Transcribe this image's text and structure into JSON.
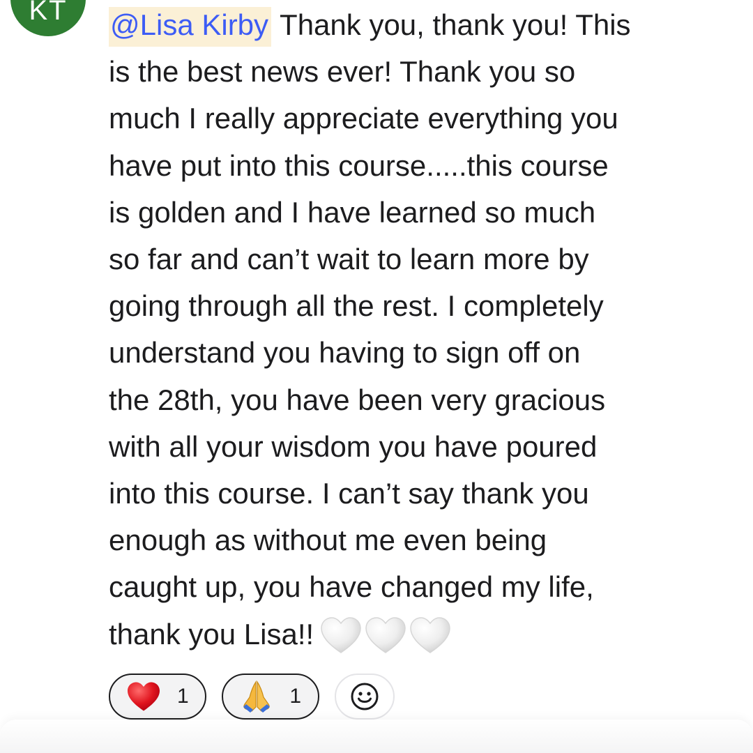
{
  "author": {
    "initials": "KT",
    "avatar_color": "#2e7d32"
  },
  "comment": {
    "mention": "@Lisa Kirby",
    "mention_color": "#3d5cf5",
    "mention_highlight": "#fbf0d6",
    "lines": [
      "Thank you, thank you! This",
      "is the best news ever! Thank you so",
      "much I really appreciate everything you",
      "have put into this course.....this course",
      "is golden and I have learned so much",
      "so far and can’t wait to learn more by",
      "going through all the rest. I completely",
      "understand you having to sign off on",
      "the 28th, you have been very gracious",
      "with all your wisdom you have poured",
      "into this course. I can’t say thank you",
      "enough as without me even being",
      "caught up, you have changed my life,",
      "thank you Lisa!!"
    ],
    "trailing_emoji": [
      "white-heart-icon",
      "white-heart-icon",
      "white-heart-icon"
    ]
  },
  "reactions": [
    {
      "emoji": "red-heart-icon",
      "count": "1"
    },
    {
      "emoji": "folded-hands-icon",
      "count": "1"
    }
  ],
  "add_reaction": {
    "icon": "smiley-add-icon"
  }
}
